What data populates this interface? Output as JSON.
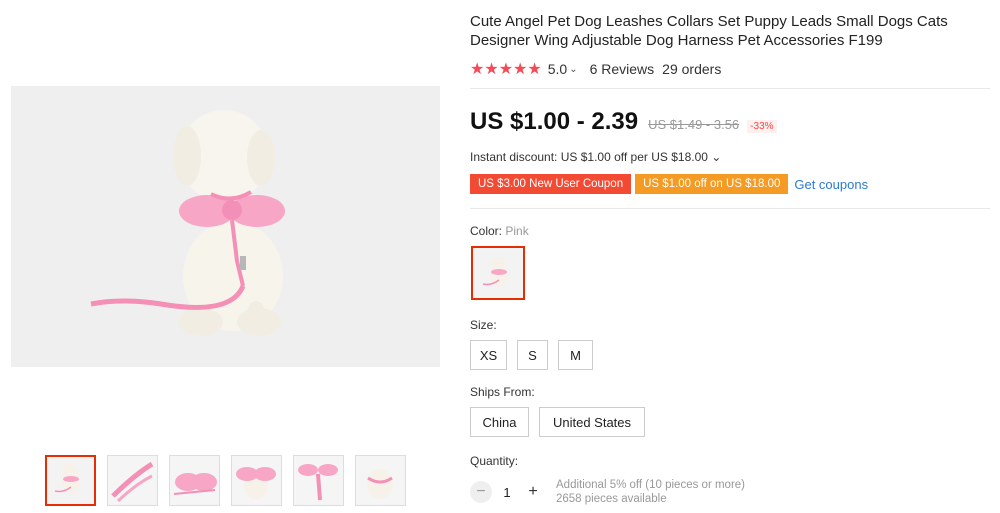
{
  "product": {
    "title": "Cute Angel Pet Dog Leashes Collars Set Puppy Leads Small Dogs Cats Designer Wing Adjustable Dog Harness Pet Accessories F199",
    "stars": "★★★★★",
    "rating": "5.0",
    "reviews": "6 Reviews",
    "orders": "29 orders"
  },
  "pricing": {
    "price": "US $1.00 - 2.39",
    "original": "US $1.49 - 3.56",
    "discount": "-33%",
    "instant_discount": "Instant discount: US $1.00 off per US $18.00 ⌄",
    "coupon_new_user": "US $3.00 New User Coupon",
    "coupon_off": "US $1.00 off on US $18.00",
    "get_coupons": "Get coupons"
  },
  "color": {
    "label": "Color:",
    "selected": "Pink"
  },
  "size": {
    "label": "Size:",
    "options": [
      "XS",
      "S",
      "M"
    ]
  },
  "ships": {
    "label": "Ships From:",
    "options": [
      "China",
      "United States"
    ]
  },
  "quantity": {
    "label": "Quantity:",
    "minus": "−",
    "value": "1",
    "plus": "+",
    "note_line1": "Additional 5% off (10 pieces or more)",
    "note_line2": "2658 pieces available"
  },
  "colors": {
    "accent_red": "#e62e04",
    "star": "#f64a58",
    "coupon_red": "#f34a33",
    "coupon_orange": "#f59a23",
    "link_blue": "#2a7ad5",
    "harness_pink": "#f7a6c6"
  }
}
